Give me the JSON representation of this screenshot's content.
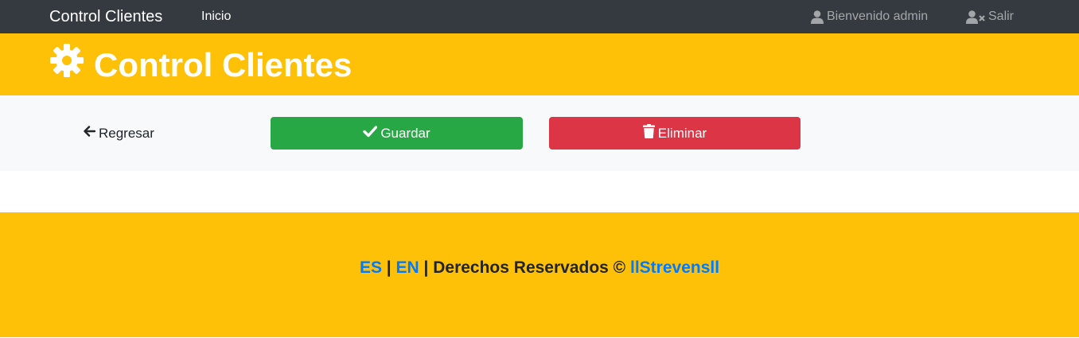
{
  "navbar": {
    "brand": "Control Clientes",
    "links": {
      "home": "Inicio"
    },
    "welcome": "Bienvenido admin",
    "logout": "Salir",
    "icons": {
      "welcome": "user-icon",
      "logout": "user-times-icon"
    }
  },
  "header": {
    "title": "Control Clientes",
    "icon": "gear-icon"
  },
  "actions": {
    "back": "Regresar",
    "save": "Guardar",
    "delete": "Eliminar",
    "icons": {
      "back": "arrow-left-icon",
      "save": "check-icon",
      "delete": "trash-icon"
    }
  },
  "footer": {
    "lang_es": "ES",
    "sep1": " | ",
    "lang_en": "EN",
    "rights": " | Derechos Reservados © ",
    "author": "llStrevensll"
  },
  "colors": {
    "navbar": "#343a40",
    "brand_bg": "#ffc107",
    "actions_bg": "#f8f9fa",
    "success": "#28a745",
    "danger": "#dc3545",
    "link": "#007bff"
  }
}
